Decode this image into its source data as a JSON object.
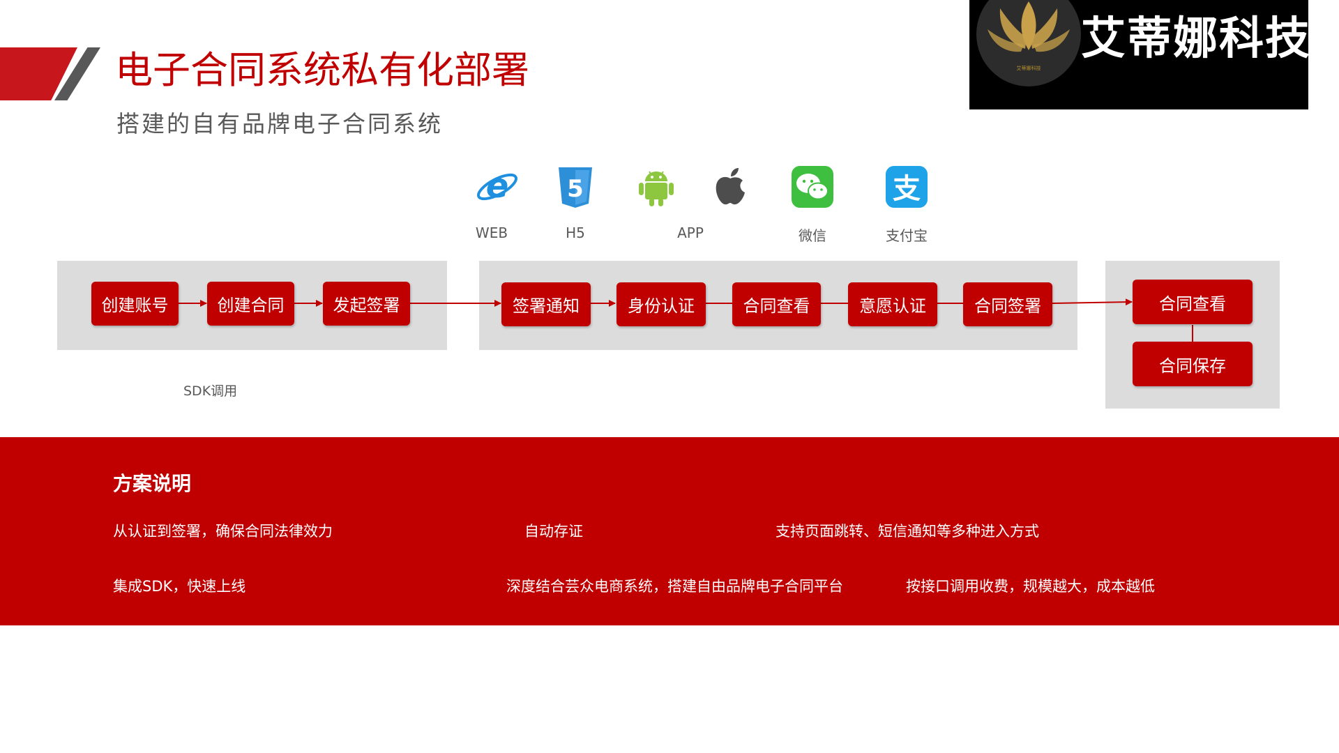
{
  "header": {
    "title": "电子合同系统私有化部署",
    "subtitle": "搭建的自有品牌电子合同系统"
  },
  "logo": {
    "name": "艾蒂娜科技",
    "small_text": "艾蒂娜科技"
  },
  "platforms": [
    {
      "label": "WEB",
      "icon": "ie-browser-icon"
    },
    {
      "label": "H5",
      "icon": "html5-icon"
    },
    {
      "label": "APP",
      "icon": "android-icon"
    },
    {
      "label": "",
      "icon": "apple-icon"
    },
    {
      "label": "微信",
      "icon": "wechat-icon"
    },
    {
      "label": "支付宝",
      "icon": "alipay-icon"
    }
  ],
  "flow": {
    "group1": [
      "创建账号",
      "创建合同",
      "发起签署"
    ],
    "group2": [
      "签署通知",
      "身份认证",
      "合同查看",
      "意愿认证",
      "合同签署"
    ],
    "group3": [
      "合同查看",
      "合同保存"
    ],
    "sdk_label": "SDK调用"
  },
  "solution": {
    "title": "方案说明",
    "features": [
      "从认证到签署，确保合同法律效力",
      "自动存证",
      "支持页面跳转、短信通知等多种进入方式",
      "集成SDK，快速上线",
      "深度结合芸众电商系统，搭建自由品牌电子合同平台",
      "按接口调用收费，规模越大，成本越低"
    ]
  },
  "colors": {
    "brand_red": "#c00000",
    "accent_gray": "#585858",
    "panel_gray": "#dcdcdc"
  }
}
